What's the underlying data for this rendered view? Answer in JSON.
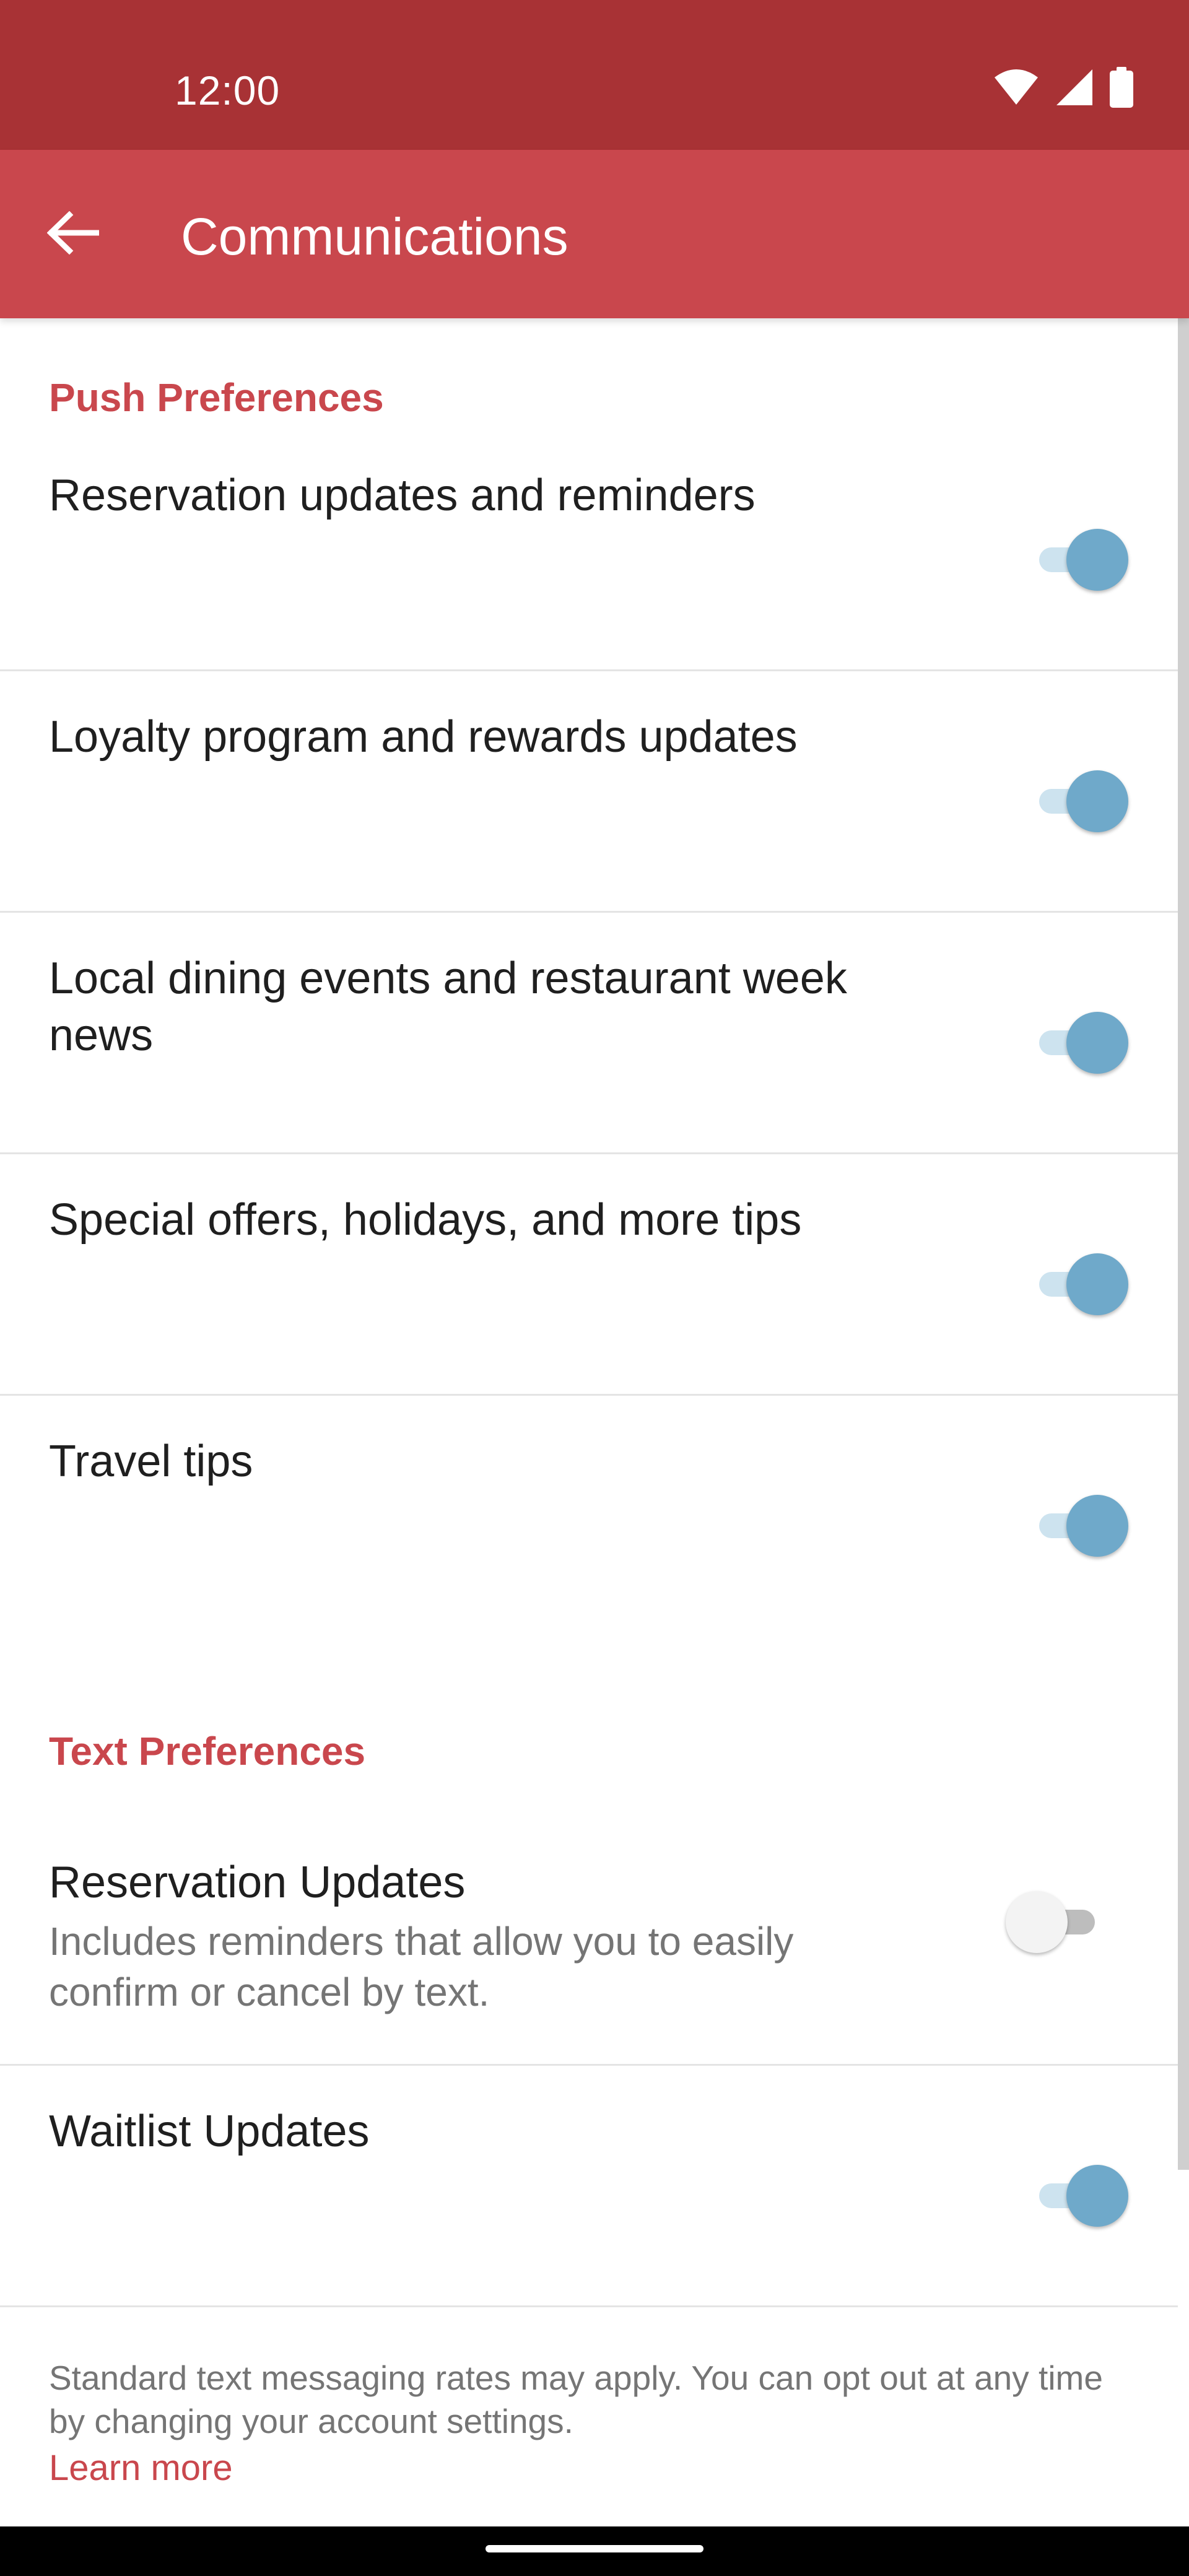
{
  "status_bar": {
    "time": "12:00",
    "icons": [
      "wifi-icon",
      "signal-icon",
      "battery-icon"
    ]
  },
  "app_bar": {
    "title": "Communications",
    "back_icon": "arrow-left-icon"
  },
  "push_preferences": {
    "header": "Push Preferences",
    "items": [
      {
        "label": "Reservation updates and reminders",
        "enabled": true
      },
      {
        "label": "Loyalty program and rewards updates",
        "enabled": true
      },
      {
        "label": "Local dining events and restaurant week news",
        "enabled": true
      },
      {
        "label": "Special offers, holidays, and more tips",
        "enabled": true
      },
      {
        "label": "Travel tips",
        "enabled": true
      }
    ]
  },
  "text_preferences": {
    "header": "Text Preferences",
    "items": [
      {
        "label": "Reservation Updates",
        "description": "Includes reminders that allow you to easily confirm or cancel by text.",
        "enabled": false
      },
      {
        "label": "Waitlist Updates",
        "enabled": true
      }
    ]
  },
  "footer": {
    "note": "Standard text messaging rates may apply. You can opt out at any time by changing your account settings.",
    "learn_more": "Learn more"
  },
  "colors": {
    "status_bar": "#a83235",
    "app_bar": "#c9474d",
    "accent": "#c9474d",
    "toggle_on": "#6fa9ca",
    "toggle_on_track": "#cde3ef"
  }
}
